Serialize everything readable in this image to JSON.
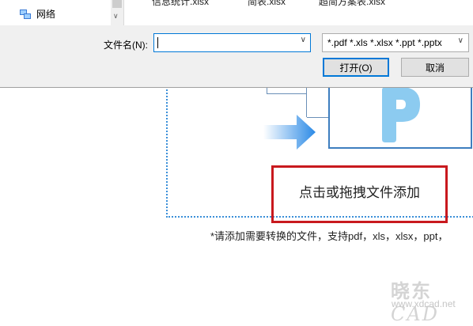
{
  "nav": {
    "network_label": "网络"
  },
  "files": [
    "信息统计.xlsx",
    "简表.xlsx",
    "超简方案表.xlsx"
  ],
  "dialog": {
    "filename_label": "文件名(N):",
    "filename_value": "",
    "filter_value": "*.pdf *.xls *.xlsx *.ppt *.pptx",
    "open_label": "打开(O)",
    "cancel_label": "取消"
  },
  "app": {
    "dropzone_hint": "点击或拖拽文件添加",
    "support_text": "*请添加需要转换的文件，支持pdf，xls，xlsx，ppt，"
  },
  "watermark": {
    "logo": "晓东CAD",
    "url": "www.xdcad.net"
  },
  "colors": {
    "accent": "#0078d7",
    "highlight": "#c8191e",
    "brand_p": "#8ccbf0"
  }
}
